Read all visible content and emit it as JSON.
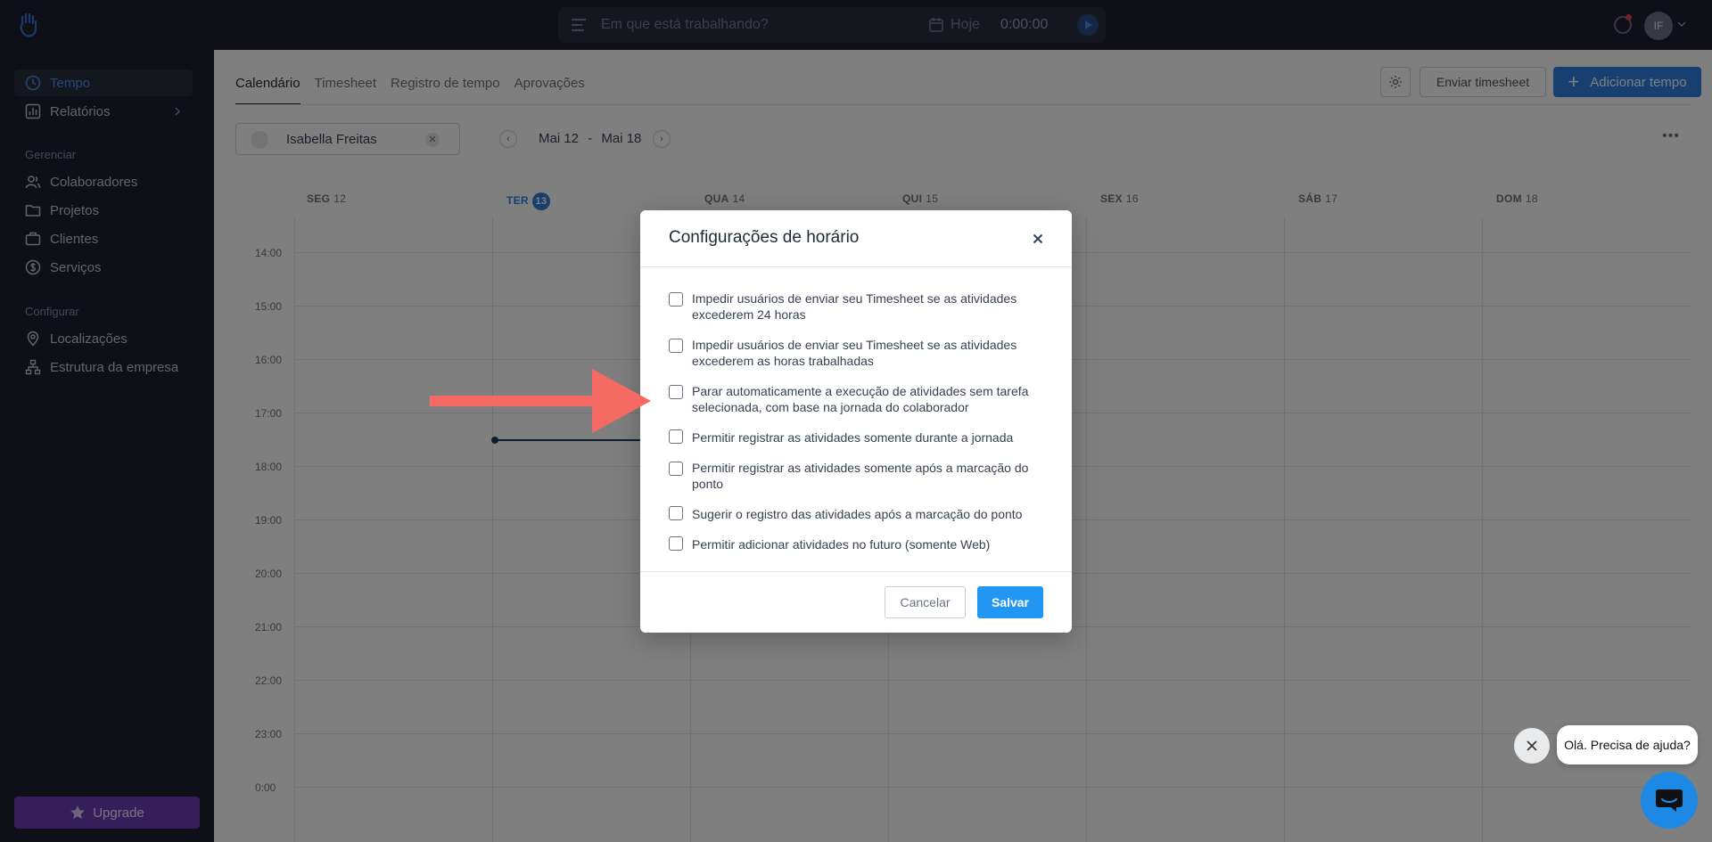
{
  "topbar": {
    "timer_placeholder": "Em que está trabalhando?",
    "today_label": "Hoje",
    "time": "0:00:00",
    "avatar_initials": "IF"
  },
  "sidebar": {
    "items_top": [
      {
        "label": "Tempo",
        "icon": "clock-icon"
      },
      {
        "label": "Relatórios",
        "icon": "bar-chart-icon"
      }
    ],
    "section_manage": "Gerenciar",
    "items_manage": [
      {
        "label": "Colaboradores",
        "icon": "users-icon"
      },
      {
        "label": "Projetos",
        "icon": "folder-icon"
      },
      {
        "label": "Clientes",
        "icon": "briefcase-icon"
      },
      {
        "label": "Serviços",
        "icon": "dollar-icon"
      }
    ],
    "section_config": "Configurar",
    "items_config": [
      {
        "label": "Localizações",
        "icon": "location-pin-icon"
      },
      {
        "label": "Estrutura da empresa",
        "icon": "org-chart-icon"
      }
    ],
    "upgrade_label": "Upgrade"
  },
  "main": {
    "tabs": [
      {
        "label": "Calendário"
      },
      {
        "label": "Timesheet"
      },
      {
        "label": "Registro de tempo"
      },
      {
        "label": "Aprovações"
      }
    ],
    "send_timesheet_label": "Enviar timesheet",
    "add_time_label": "Adicionar tempo",
    "user_filter": "Isabella Freitas",
    "week_start": "Mai 12",
    "week_sep": "-",
    "week_end": "Mai 18",
    "days": [
      {
        "name": "SEG",
        "num": "12"
      },
      {
        "name": "TER",
        "num": "13"
      },
      {
        "name": "QUA",
        "num": "14"
      },
      {
        "name": "QUI",
        "num": "15"
      },
      {
        "name": "SEX",
        "num": "16"
      },
      {
        "name": "SÁB",
        "num": "17"
      },
      {
        "name": "DOM",
        "num": "18"
      }
    ],
    "hours": [
      "14:00",
      "15:00",
      "16:00",
      "17:00",
      "18:00",
      "19:00",
      "20:00",
      "21:00",
      "22:00",
      "23:00",
      "0:00"
    ]
  },
  "modal": {
    "title": "Configurações de horário",
    "options": [
      {
        "label": "Impedir usuários de enviar seu Timesheet se as atividades excederem 24 horas",
        "checked": false
      },
      {
        "label": "Impedir usuários de enviar seu Timesheet se as atividades excederem as horas trabalhadas",
        "checked": false
      },
      {
        "label": "Parar automaticamente a execução de atividades sem tarefa selecionada, com base na jornada do colaborador",
        "checked": false
      },
      {
        "label": "Permitir registrar as atividades somente durante a jornada",
        "checked": false
      },
      {
        "label": "Permitir registrar as atividades somente após a marcação do ponto",
        "checked": false
      },
      {
        "label": "Sugerir o registro das atividades após a marcação do ponto",
        "checked": false
      },
      {
        "label": "Permitir adicionar atividades no futuro (somente Web)",
        "checked": false
      }
    ],
    "cancel_label": "Cancelar",
    "save_label": "Salvar"
  },
  "help": {
    "bubble_text": "Olá. Precisa de ajuda?"
  },
  "colors": {
    "accent": "#2196f3",
    "sidebar_bg": "#1c1f2e",
    "upgrade": "#6b3fb6",
    "arrow": "#f56a62"
  }
}
